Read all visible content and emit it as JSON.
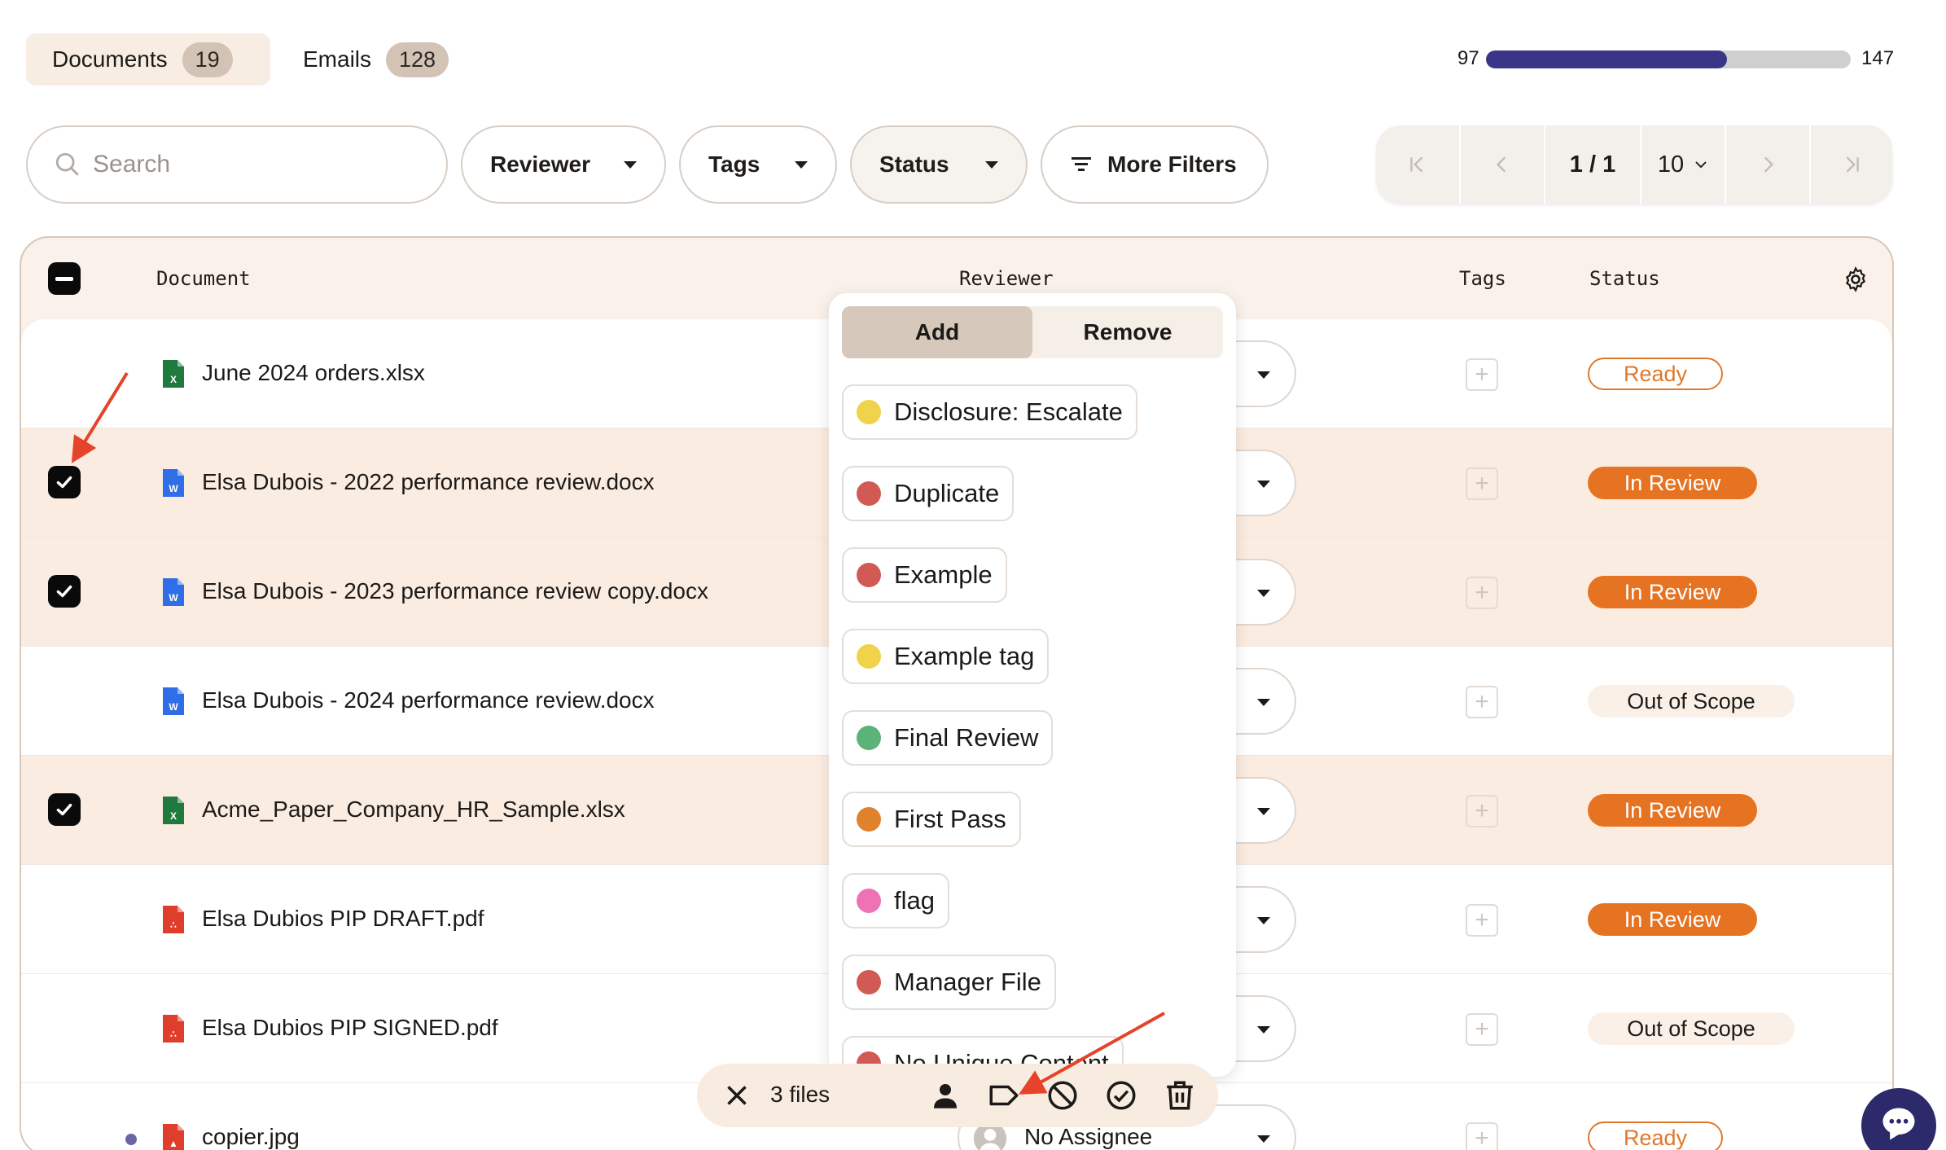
{
  "tabs": [
    {
      "label": "Documents",
      "count": "19"
    },
    {
      "label": "Emails",
      "count": "128"
    }
  ],
  "progress": {
    "left": "97",
    "right": "147",
    "fraction": 0.66
  },
  "search": {
    "placeholder": "Search"
  },
  "filters": {
    "reviewer": "Reviewer",
    "tags": "Tags",
    "status": "Status",
    "more": "More Filters"
  },
  "pager": {
    "page": "1 / 1",
    "page_size": "10"
  },
  "table": {
    "headers": {
      "document": "Document",
      "reviewer": "Reviewer",
      "tags": "Tags",
      "status": "Status"
    }
  },
  "rows": [
    {
      "name": "June 2024 orders.xlsx",
      "type": "xlsx",
      "selected": false,
      "status": "Ready"
    },
    {
      "name": "Elsa Dubois - 2022 performance review.docx",
      "type": "docx",
      "selected": true,
      "status": "In Review"
    },
    {
      "name": "Elsa Dubois - 2023 performance review copy.docx",
      "type": "docx",
      "selected": true,
      "status": "In Review"
    },
    {
      "name": "Elsa Dubois - 2024 performance review.docx",
      "type": "docx",
      "selected": false,
      "status": "Out of Scope"
    },
    {
      "name": "Acme_Paper_Company_HR_Sample.xlsx",
      "type": "xlsx",
      "selected": true,
      "status": "In Review"
    },
    {
      "name": "Elsa Dubios PIP DRAFT.pdf",
      "type": "pdf",
      "selected": false,
      "status": "In Review"
    },
    {
      "name": "Elsa Dubios PIP SIGNED.pdf",
      "type": "pdf",
      "selected": false,
      "status": "Out of Scope"
    },
    {
      "name": "copier.jpg",
      "type": "jpg",
      "selected": false,
      "status": "Ready",
      "reviewer": "No Assignee"
    }
  ],
  "tag_menu": {
    "add_label": "Add",
    "remove_label": "Remove",
    "tags": [
      {
        "label": "Disclosure: Escalate",
        "color": "#f0d34a"
      },
      {
        "label": "Duplicate",
        "color": "#d25a55"
      },
      {
        "label": "Example",
        "color": "#d25a55"
      },
      {
        "label": "Example tag",
        "color": "#f0d34a"
      },
      {
        "label": "Final Review",
        "color": "#5cb377"
      },
      {
        "label": "First Pass",
        "color": "#e0822c"
      },
      {
        "label": "flag",
        "color": "#ee72b6"
      },
      {
        "label": "Manager File",
        "color": "#d25a55"
      },
      {
        "label": "No Unique Content",
        "color": "#d25a55"
      }
    ]
  },
  "action_bar": {
    "count": "3 files"
  },
  "colors": {
    "accent": "#3b3587",
    "in_review": "#e57322",
    "ready": "#e0782c",
    "annotation": "#e6432b"
  }
}
